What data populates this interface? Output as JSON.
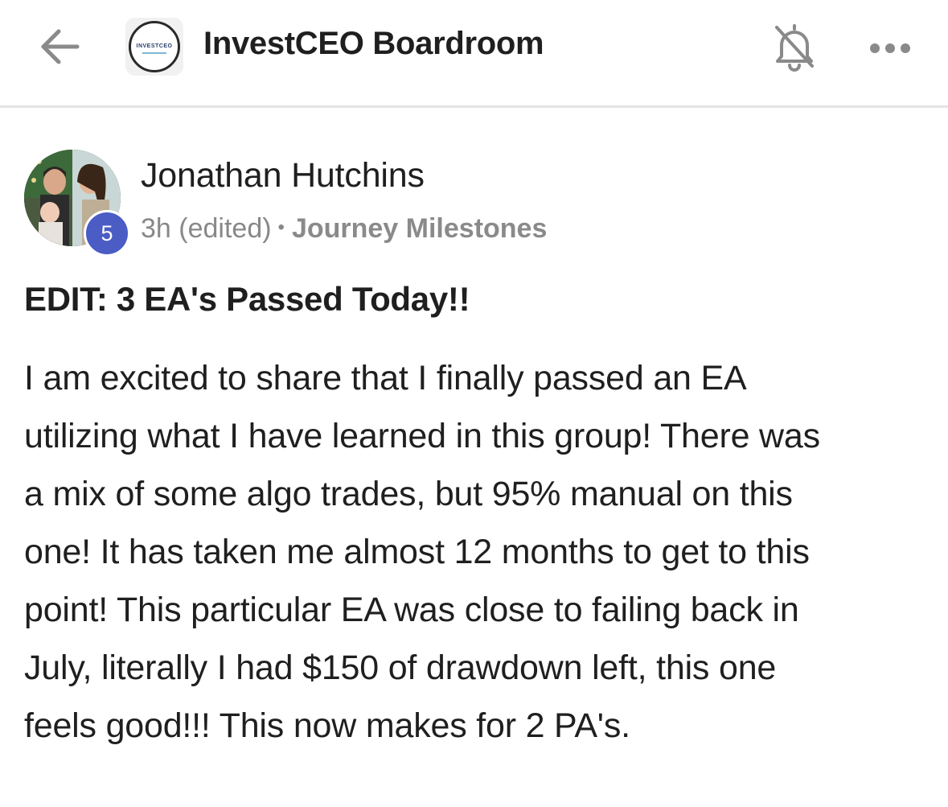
{
  "header": {
    "back_icon": "arrow-left-icon",
    "group_logo_text": "INVESTCEO",
    "group_name": "InvestCEO Boardroom",
    "notification_icon": "bell-off-icon",
    "more_icon": "more-horizontal-icon"
  },
  "post": {
    "author": {
      "name": "Jonathan Hutchins",
      "level": "5"
    },
    "time": "3h (edited)",
    "separator": "•",
    "category": "Journey Milestones",
    "title": "EDIT: 3 EA's Passed Today!!",
    "body_lines": [
      "I am excited to share that I finally passed an EA",
      "utilizing what I have learned in this group! There was",
      "a mix of some algo trades, but 95% manual on this",
      "one! It has taken me almost 12 months to get to this",
      "point! This particular EA was close to failing back in",
      "July, literally I had $150 of drawdown left, this one",
      "feels good!!! This now makes for 2 PA's."
    ]
  },
  "colors": {
    "badge": "#4b5cc4",
    "meta_text": "#888888",
    "divider": "#e4e4e4",
    "icon": "#8a8a8a"
  }
}
